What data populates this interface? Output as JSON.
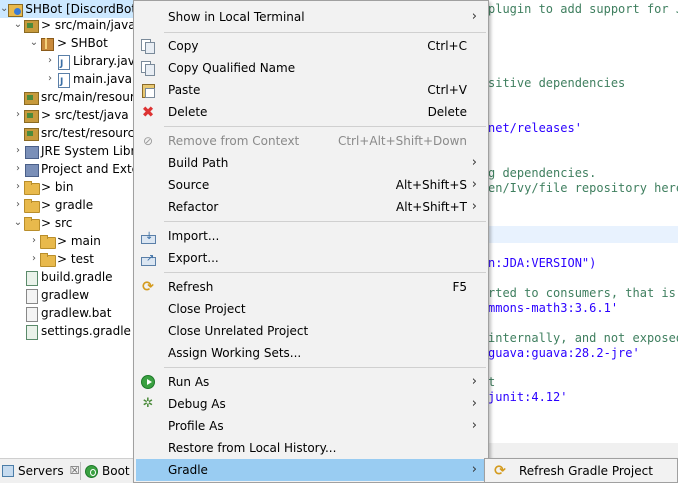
{
  "explorer": {
    "rows": [
      {
        "twisty": "⌄",
        "icon": "project-icon",
        "label": "> SHBot [DiscordBot]",
        "selected": true
      },
      {
        "twisty": "⌄",
        "icon": "source-folder-icon",
        "label": "> src/main/java"
      },
      {
        "twisty": "⌄",
        "icon": "package-icon",
        "label": "> SHBot"
      },
      {
        "twisty": "›",
        "icon": "java-file-icon",
        "label": "Library.java"
      },
      {
        "twisty": "›",
        "icon": "java-file-icon",
        "label": "main.java"
      },
      {
        "twisty": "",
        "icon": "source-folder-icon",
        "label": "src/main/resources"
      },
      {
        "twisty": "›",
        "icon": "source-folder-icon",
        "label": "> src/test/java"
      },
      {
        "twisty": "",
        "icon": "source-folder-icon",
        "label": "src/test/resources"
      },
      {
        "twisty": "›",
        "icon": "library-icon",
        "label": "JRE System Library"
      },
      {
        "twisty": "›",
        "icon": "library-icon",
        "label": "Project and External"
      },
      {
        "twisty": "›",
        "icon": "folder-icon",
        "label": "> bin"
      },
      {
        "twisty": "›",
        "icon": "folder-icon",
        "label": "> gradle"
      },
      {
        "twisty": "⌄",
        "icon": "folder-icon",
        "label": "> src"
      },
      {
        "twisty": "›",
        "icon": "folder-icon",
        "label": "> main"
      },
      {
        "twisty": "›",
        "icon": "folder-icon",
        "label": "> test"
      },
      {
        "twisty": "",
        "icon": "gradle-file-icon",
        "label": "build.gradle"
      },
      {
        "twisty": "",
        "icon": "file-icon",
        "label": "gradlew"
      },
      {
        "twisty": "",
        "icon": "file-icon",
        "label": "gradlew.bat"
      },
      {
        "twisty": "",
        "icon": "gradle-file-icon",
        "label": "settings.gradle"
      }
    ]
  },
  "editor": {
    "lines": [
      {
        "text": "plugin to add support for Ja",
        "kind": "comment"
      },
      {
        "text": "sitive dependencies",
        "kind": "comment"
      },
      {
        "text": "net/releases'",
        "kind": "string"
      },
      {
        "text": "g dependencies.",
        "kind": "comment"
      },
      {
        "text": "en/Ivy/file repository here.",
        "kind": "comment"
      },
      {
        "text": "n:JDA:VERSION\")",
        "kind": "string"
      },
      {
        "text": "rted to consumers, that is t",
        "kind": "comment"
      },
      {
        "text": "mmons-math3:3.6.1'",
        "kind": "string"
      },
      {
        "text": "internally, and not exposed",
        "kind": "comment"
      },
      {
        "text": "guava:guava:28.2-jre'",
        "kind": "string"
      },
      {
        "text": "t",
        "kind": "comment"
      },
      {
        "text": "junit:4.12'",
        "kind": "string"
      }
    ]
  },
  "bottom_bar": {
    "servers_label": "Servers",
    "servers_close": "☒",
    "boot_label": "Boot"
  },
  "context_menu": {
    "items": [
      {
        "id": "show-in-local-terminal",
        "label": "Show in Local Terminal",
        "shortcut": "",
        "submenu": true,
        "icon": ""
      },
      {
        "id": "copy",
        "label": "Copy",
        "shortcut": "Ctrl+C",
        "submenu": false,
        "icon": "copy-icon"
      },
      {
        "id": "copy-qualified-name",
        "label": "Copy Qualified Name",
        "shortcut": "",
        "submenu": false,
        "icon": "copy-qualified-icon"
      },
      {
        "id": "paste",
        "label": "Paste",
        "shortcut": "Ctrl+V",
        "submenu": false,
        "icon": "paste-icon"
      },
      {
        "id": "delete",
        "label": "Delete",
        "shortcut": "Delete",
        "submenu": false,
        "icon": "delete-icon"
      },
      {
        "id": "remove-from-context",
        "label": "Remove from Context",
        "shortcut": "Ctrl+Alt+Shift+Down",
        "submenu": false,
        "disabled": true,
        "icon": "remove-context-icon"
      },
      {
        "id": "build-path",
        "label": "Build Path",
        "shortcut": "",
        "submenu": true,
        "icon": ""
      },
      {
        "id": "source",
        "label": "Source",
        "shortcut": "Alt+Shift+S",
        "submenu": true,
        "icon": ""
      },
      {
        "id": "refactor",
        "label": "Refactor",
        "shortcut": "Alt+Shift+T",
        "submenu": true,
        "icon": ""
      },
      {
        "id": "import",
        "label": "Import...",
        "shortcut": "",
        "submenu": false,
        "icon": "import-icon"
      },
      {
        "id": "export",
        "label": "Export...",
        "shortcut": "",
        "submenu": false,
        "icon": "export-icon"
      },
      {
        "id": "refresh",
        "label": "Refresh",
        "shortcut": "F5",
        "submenu": false,
        "icon": "refresh-icon"
      },
      {
        "id": "close-project",
        "label": "Close Project",
        "shortcut": "",
        "submenu": false,
        "icon": ""
      },
      {
        "id": "close-unrelated-project",
        "label": "Close Unrelated Project",
        "shortcut": "",
        "submenu": false,
        "icon": ""
      },
      {
        "id": "assign-working-sets",
        "label": "Assign Working Sets...",
        "shortcut": "",
        "submenu": false,
        "icon": ""
      },
      {
        "id": "run-as",
        "label": "Run As",
        "shortcut": "",
        "submenu": true,
        "icon": "run-icon"
      },
      {
        "id": "debug-as",
        "label": "Debug As",
        "shortcut": "",
        "submenu": true,
        "icon": "debug-icon"
      },
      {
        "id": "profile-as",
        "label": "Profile As",
        "shortcut": "",
        "submenu": true,
        "icon": ""
      },
      {
        "id": "restore-from-local-history",
        "label": "Restore from Local History...",
        "shortcut": "",
        "submenu": false,
        "icon": ""
      },
      {
        "id": "gradle",
        "label": "Gradle",
        "shortcut": "",
        "submenu": true,
        "highlighted": true,
        "icon": ""
      }
    ]
  },
  "submenu": {
    "items": [
      {
        "id": "refresh-gradle-project",
        "label": "Refresh Gradle Project",
        "icon": "gradle-refresh-icon"
      }
    ]
  },
  "colors": {
    "menu_bg": "#f2f2f2",
    "menu_highlight": "#99ccf2",
    "selection": "#cce8ff",
    "comment": "#3f7f5f",
    "string": "#2a00ff"
  }
}
